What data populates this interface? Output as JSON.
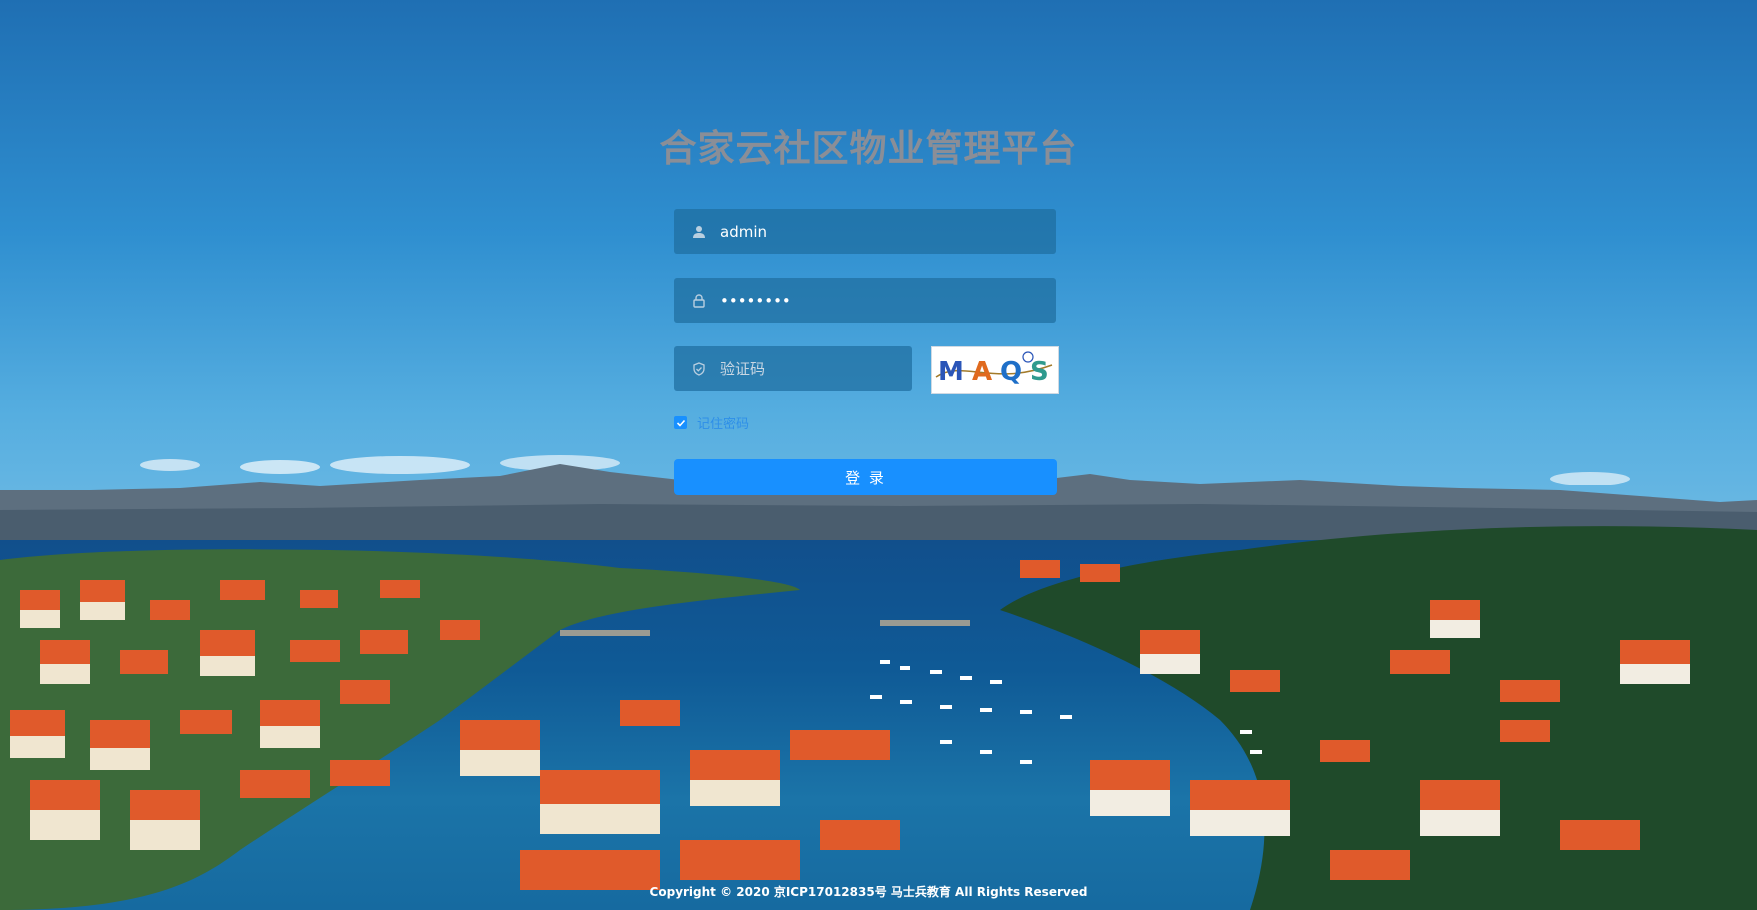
{
  "page": {
    "title": "合家云社区物业管理平台",
    "footer": "Copyright © 2020 京ICP17012835号 马士兵教育 All Rights Reserved"
  },
  "form": {
    "username_value": "admin",
    "password_value": "••••••••",
    "captcha_placeholder": "验证码",
    "captcha_image_text": "MAQS",
    "remember_label": "记住密码",
    "remember_checked": true,
    "login_label": "登 录"
  },
  "icons": {
    "username": "user-icon",
    "password": "lock-icon",
    "captcha": "shield-icon",
    "checkbox": "check-icon"
  },
  "colors": {
    "primary": "#1890ff",
    "title": "#8a8e97"
  }
}
